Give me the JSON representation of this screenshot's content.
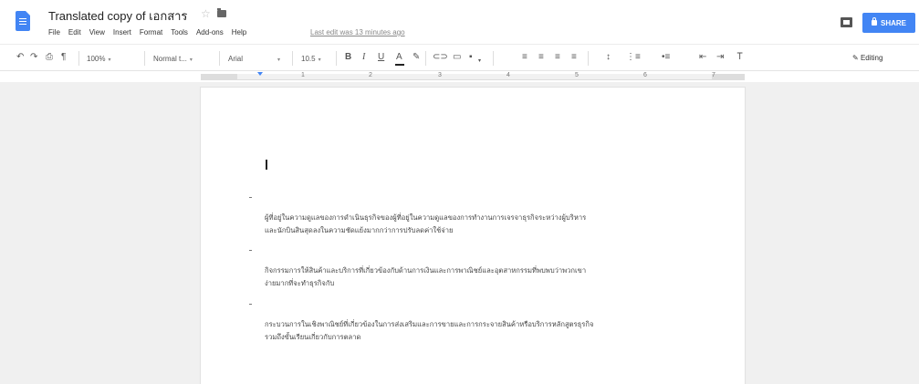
{
  "header": {
    "title": "Translated copy of เอกสาร",
    "menu": [
      "File",
      "Edit",
      "View",
      "Insert",
      "Format",
      "Tools",
      "Add-ons",
      "Help"
    ],
    "last_edit": "Last edit was 13 minutes ago",
    "share_label": "SHARE",
    "accent_color": "#4285f4"
  },
  "toolbar": {
    "undo_icon": "undo-icon",
    "redo_icon": "redo-icon",
    "print_icon": "print-icon",
    "paint_format_icon": "paint-format-icon",
    "zoom": "100%",
    "style": "Normal t...",
    "font": "Arial",
    "font_size": "10.5",
    "bold": "B",
    "italic": "I",
    "underline": "U",
    "text_color": "A",
    "clear_formatting": "Ꭲ",
    "editing_label": "Editing"
  },
  "ruler": {
    "numbers": [
      "1",
      "2",
      "3",
      "4",
      "5",
      "6",
      "7"
    ]
  },
  "document": {
    "paragraphs": [
      {
        "line1": "ผู้ที่อยู่ในความดูแลของการดำเนินธุรกิจของผู้ที่อยู่ในความดูแลของการทำงานการเจรจาธุรกิจระหว่างผู้บริหาร",
        "line2": "และนักบินสินสุดลงในความชัดแย้งมากกว่าการปรับลดค่าใช้จ่าย"
      },
      {
        "line1": "กิจกรรมการให้สินค้าและบริการที่เกี่ยวข้องกับด้านการเงินและการพาณิชย์และอุตสาหกรรมที่พบพบว่าพวกเขา",
        "line2": "ง่ายมากที่จะทำธุรกิจกับ"
      },
      {
        "line1": "กระบวนการในเชิงพาณิชย์ที่เกี่ยวข้องในการส่งเสริมและการขายและการกระจายสินค้าหรือบริการหลักสูตรธุรกิจ",
        "line2": "รวมถึงขั้นเรียนเกี่ยวกับการตลาด"
      }
    ]
  }
}
